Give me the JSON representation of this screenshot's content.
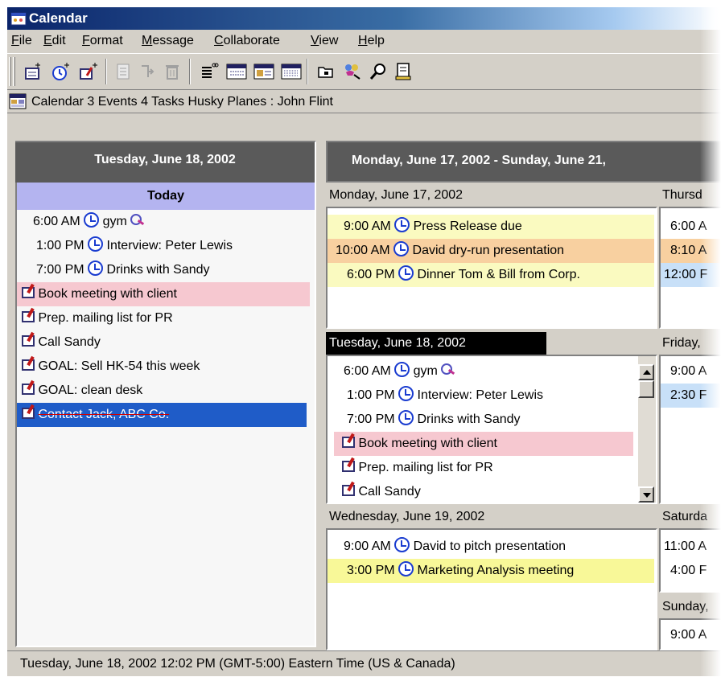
{
  "window": {
    "title": "Calendar"
  },
  "menu": [
    "File",
    "Edit",
    "Format",
    "Message",
    "Collaborate",
    "View",
    "Help"
  ],
  "toolbar": {
    "icons": [
      "new-appointment-icon",
      "new-event-icon",
      "new-task-icon",
      "print-icon",
      "forward-icon",
      "delete-icon",
      "day-view-icon",
      "week-view-icon",
      "month-view-icon",
      "year-view-icon",
      "open-folder-icon",
      "find-people-icon",
      "search-icon",
      "address-book-icon"
    ]
  },
  "infobar": {
    "text": "Calendar   3 Events  4 Tasks  Husky Planes : John Flint"
  },
  "left": {
    "date_header": "Tuesday, June 18, 2002",
    "today_label": "Today",
    "events": [
      {
        "time": "6:00 AM",
        "title": "gym"
      },
      {
        "time": "1:00 PM",
        "title": "Interview: Peter Lewis"
      },
      {
        "time": "7:00 PM",
        "title": "Drinks with Sandy"
      }
    ],
    "tasks": [
      {
        "title": "Book meeting with client"
      },
      {
        "title": "Prep. mailing list for PR"
      },
      {
        "title": "Call Sandy"
      },
      {
        "title": "GOAL: Sell HK-54 this week"
      },
      {
        "title": "GOAL: clean desk"
      },
      {
        "title": "Contact Jack, ABC Co."
      }
    ]
  },
  "right": {
    "range_header": "Monday, June 17, 2002 - Sunday, June 21,",
    "monday": {
      "label": "Monday, June 17, 2002",
      "events": [
        {
          "time": "9:00 AM",
          "title": "Press Release due"
        },
        {
          "time": "10:00 AM",
          "title": "David dry-run presentation"
        },
        {
          "time": "6:00 PM",
          "title": "Dinner Tom & Bill from Corp."
        }
      ]
    },
    "tuesday": {
      "label": "Tuesday, June 18, 2002",
      "events": [
        {
          "time": "6:00 AM",
          "title": "gym"
        },
        {
          "time": "1:00 PM",
          "title": "Interview: Peter Lewis"
        },
        {
          "time": "7:00 PM",
          "title": "Drinks with Sandy"
        }
      ],
      "tasks": [
        {
          "title": "Book meeting with client"
        },
        {
          "title": "Prep. mailing list for PR"
        },
        {
          "title": "Call Sandy"
        }
      ]
    },
    "wednesday": {
      "label": "Wednesday, June 19, 2002",
      "events": [
        {
          "time": "9:00 AM",
          "title": "David to pitch presentation"
        },
        {
          "time": "3:00 PM",
          "title": "Marketing Analysis meeting"
        }
      ]
    },
    "thursday": {
      "label": "Thursd",
      "times": [
        "6:00 A",
        "8:10 A",
        "12:00 F"
      ]
    },
    "friday": {
      "label": "Friday, ",
      "times": [
        "9:00 A",
        "2:30 F"
      ]
    },
    "saturday": {
      "label": "Saturda",
      "times": [
        "11:00 A",
        "4:00 F"
      ]
    },
    "sunday": {
      "label": "Sunday,",
      "times": [
        "9:00 A"
      ]
    }
  },
  "status": {
    "text": "Tuesday, June 18, 2002 12:02 PM (GMT-5:00) Eastern Time (US & Canada)"
  }
}
